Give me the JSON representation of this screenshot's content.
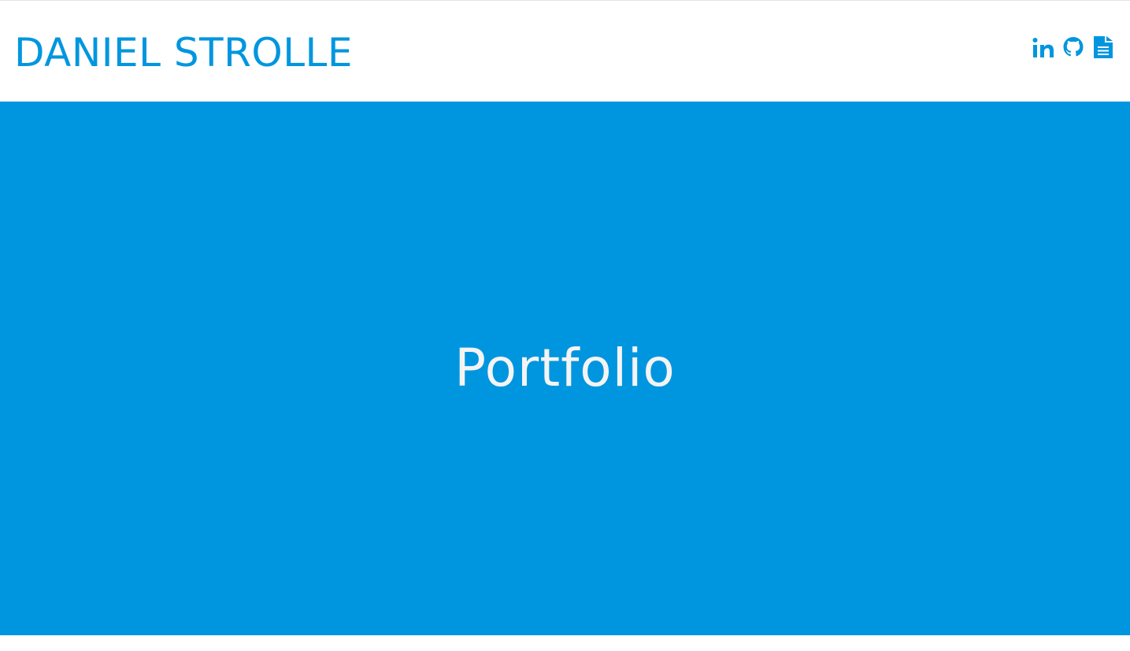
{
  "header": {
    "brand": "DANIEL STROLLE",
    "social_icons": [
      "linkedin-icon",
      "github-icon",
      "document-icon"
    ]
  },
  "hero": {
    "title": "Portfolio"
  },
  "colors": {
    "accent": "#0096df",
    "hero_text": "#f4f4f4",
    "background": "#ffffff"
  }
}
